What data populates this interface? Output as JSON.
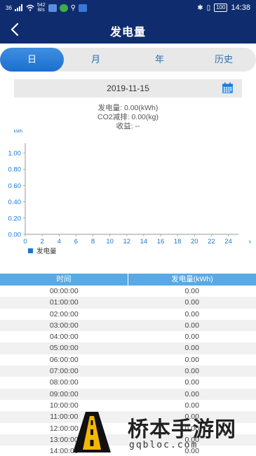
{
  "status_bar": {
    "signal": "36",
    "net_speed_top": "542",
    "net_speed_bottom": "B/s",
    "battery": "100",
    "time": "14:38"
  },
  "header": {
    "title": "发电量",
    "back_icon": "chevron-left-icon"
  },
  "tabs": [
    {
      "label": "日",
      "active": true
    },
    {
      "label": "月",
      "active": false
    },
    {
      "label": "年",
      "active": false
    },
    {
      "label": "历史",
      "active": false
    }
  ],
  "date_picker": {
    "value": "2019-11-15",
    "icon": "calendar-icon"
  },
  "summary": {
    "power": "发电量: 0.00(kWh)",
    "co2": "CO2减排: 0.00(kg)",
    "income": "收益: --"
  },
  "chart_data": {
    "type": "bar",
    "ylabel": "kWh",
    "xlabel": "h",
    "ylim": [
      0,
      1.0
    ],
    "yticks": [
      "0.00",
      "0.20",
      "0.40",
      "0.60",
      "0.80",
      "1.00"
    ],
    "xticks": [
      "0",
      "2",
      "4",
      "6",
      "8",
      "10",
      "12",
      "14",
      "16",
      "18",
      "20",
      "22",
      "24"
    ],
    "series": [
      {
        "name": "发电量",
        "color": "#1976d2",
        "values": []
      }
    ],
    "legend": "bottom-left"
  },
  "table": {
    "headers": [
      "时间",
      "发电量(kWh)"
    ],
    "rows": [
      [
        "00:00:00",
        "0.00"
      ],
      [
        "01:00:00",
        "0.00"
      ],
      [
        "02:00:00",
        "0.00"
      ],
      [
        "03:00:00",
        "0.00"
      ],
      [
        "04:00:00",
        "0.00"
      ],
      [
        "05:00:00",
        "0.00"
      ],
      [
        "06:00:00",
        "0.00"
      ],
      [
        "07:00:00",
        "0.00"
      ],
      [
        "08:00:00",
        "0.00"
      ],
      [
        "09:00:00",
        "0.00"
      ],
      [
        "10:00:00",
        "0.00"
      ],
      [
        "11:00:00",
        "0.00"
      ],
      [
        "12:00:00",
        "0.00"
      ],
      [
        "13:00:00",
        "0.00"
      ],
      [
        "14:00:00",
        "0.00"
      ]
    ]
  },
  "watermark": {
    "title": "桥本手游网",
    "url": "gqbloc.com"
  }
}
